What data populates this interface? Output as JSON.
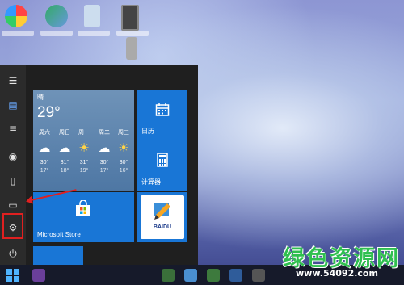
{
  "start_menu": {
    "weather": {
      "condition": "晴",
      "temperature": "29°",
      "days": [
        {
          "day": "周六",
          "icon": "cloud",
          "high": "30°",
          "low": "17°"
        },
        {
          "day": "周日",
          "icon": "cloud",
          "high": "31°",
          "low": "18°"
        },
        {
          "day": "周一",
          "icon": "sun",
          "high": "31°",
          "low": "19°"
        },
        {
          "day": "周二",
          "icon": "cloud",
          "high": "30°",
          "low": "17°"
        },
        {
          "day": "周三",
          "icon": "sun",
          "high": "30°",
          "low": "16°"
        }
      ]
    },
    "tiles": {
      "calendar": "日历",
      "calculator": "计算器",
      "store": "Microsoft Store",
      "baidu": "BAIDU"
    }
  },
  "watermark": {
    "text": "绿色资源网",
    "url": "www.54092.com"
  },
  "colors": {
    "tile_blue": "#1976d6",
    "highlight_red": "#e02020"
  }
}
